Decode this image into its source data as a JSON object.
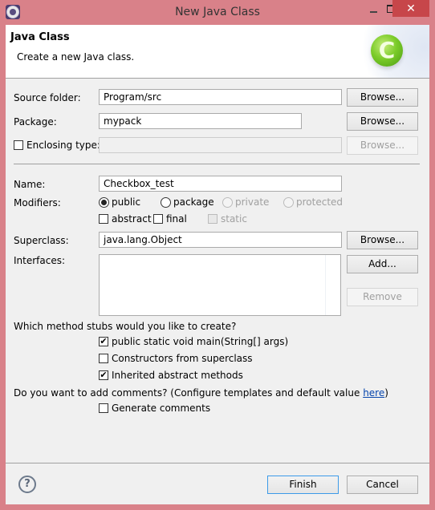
{
  "window": {
    "title": "New Java Class",
    "icons": {
      "app": "eclipse-gear-icon",
      "minimize": "minimize-icon",
      "maximize": "maximize-icon",
      "close": "close-icon"
    },
    "close_glyph": "✕"
  },
  "header": {
    "title": "Java Class",
    "description": "Create a new Java class.",
    "logo_glyph": "C",
    "logo_icon": "java-class-c-icon"
  },
  "form": {
    "source_folder": {
      "label": "Source folder:",
      "value": "Program/src",
      "browse": "Browse..."
    },
    "package": {
      "label": "Package:",
      "value": "mypack",
      "browse": "Browse..."
    },
    "enclosing_type": {
      "label": "Enclosing type:",
      "checked": false,
      "value": "",
      "browse": "Browse...",
      "enabled": false
    },
    "name": {
      "label": "Name:",
      "value": "Checkbox_test"
    },
    "modifiers": {
      "label": "Modifiers:",
      "visibility": [
        {
          "label": "public",
          "selected": true,
          "enabled": true
        },
        {
          "label": "package",
          "selected": false,
          "enabled": true
        },
        {
          "label": "private",
          "selected": false,
          "enabled": false
        },
        {
          "label": "protected",
          "selected": false,
          "enabled": false
        }
      ],
      "flags": [
        {
          "label": "abstract",
          "checked": false,
          "enabled": true
        },
        {
          "label": "final",
          "checked": false,
          "enabled": true
        },
        {
          "label": "static",
          "checked": false,
          "enabled": false
        }
      ]
    },
    "superclass": {
      "label": "Superclass:",
      "value": "java.lang.Object",
      "browse": "Browse..."
    },
    "interfaces": {
      "label": "Interfaces:",
      "items": [],
      "add": "Add...",
      "remove": "Remove"
    },
    "stubs": {
      "question": "Which method stubs would you like to create?",
      "options": [
        {
          "label": "public static void main(String[] args)",
          "checked": true
        },
        {
          "label": "Constructors from superclass",
          "checked": false
        },
        {
          "label": "Inherited abstract methods",
          "checked": true
        }
      ]
    },
    "comments": {
      "question_prefix": "Do you want to add comments? (Configure templates and default value ",
      "link": "here",
      "question_suffix": ")",
      "option": {
        "label": "Generate comments",
        "checked": false
      }
    }
  },
  "footer": {
    "help_glyph": "?",
    "finish": "Finish",
    "cancel": "Cancel"
  },
  "check_glyph": "✔"
}
